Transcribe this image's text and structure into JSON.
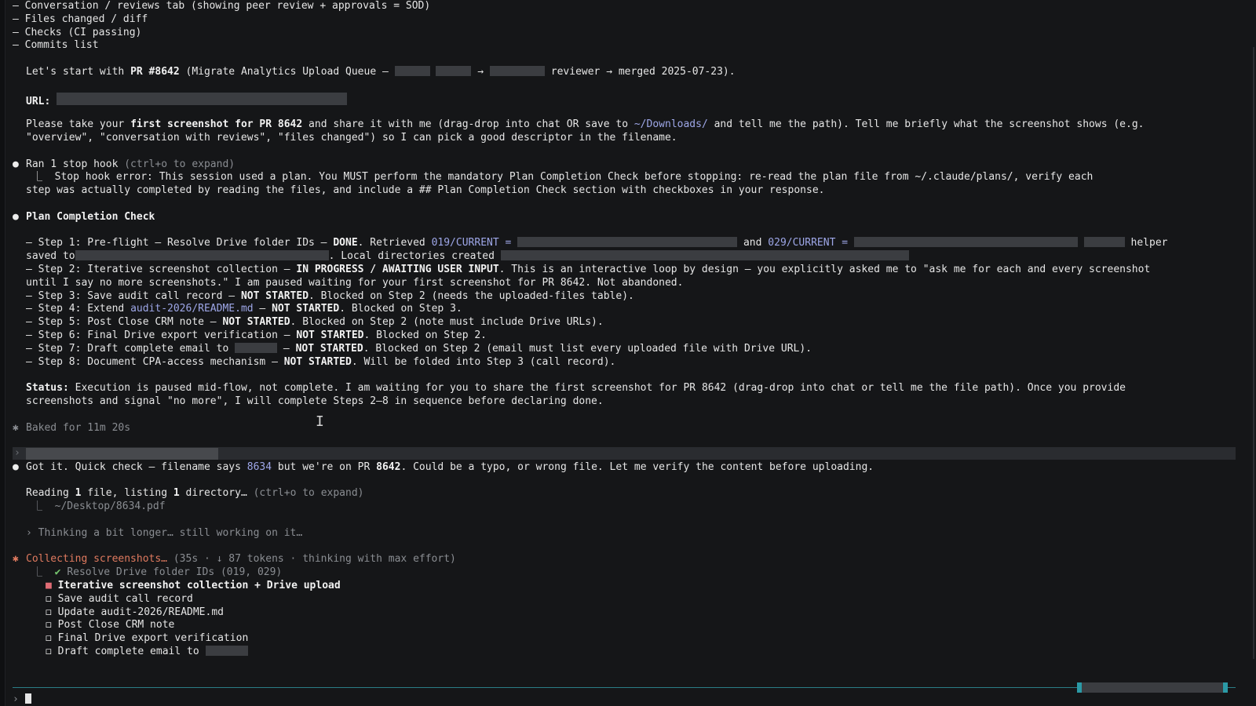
{
  "top_list": [
    "– Conversation / reviews tab (showing peer review + approvals = SOD)",
    "– Files changed / diff",
    "– Checks (CI passing)",
    "– Commits list"
  ],
  "pr_intro": {
    "prefix": "Let's start with ",
    "pr": "PR #8642",
    "mid": " (Migrate Analytics Upload Queue — ",
    "arrow1": " → ",
    "tail": " reviewer → merged 2025-07-23)."
  },
  "url_label": "URL:",
  "screenshot_request": {
    "p1": "Please take your ",
    "bold": "first screenshot for PR 8642",
    "p2": " and share it with me (drag-drop into chat OR save to ",
    "path": "~/Downloads/",
    "p3": " and tell me the path). Tell me briefly what the screenshot shows (e.g.",
    "line2": "\"overview\", \"conversation with reviews\", \"files changed\") so I can pick a good descriptor in the filename."
  },
  "stop_hook": {
    "title": "Ran 1 stop hook",
    "hint": " (ctrl+o to expand)",
    "err1": "⎿  Stop hook error: This session used a plan. You MUST perform the mandatory Plan Completion Check before stopping: re-read the plan file from ~/.claude/plans/, verify each",
    "err2": "step was actually completed by reading the files, and include a ## Plan Completion Check section with checkboxes in your response."
  },
  "plan_check_title": "Plan Completion Check",
  "steps": {
    "s1_a": "– Step 1: Pre-flight — Resolve Drive folder IDs — ",
    "s1_done": "DONE",
    "s1_b": ". Retrieved ",
    "s1_c019": "019/CURRENT =",
    "s1_and": " and ",
    "s1_c029": "029/CURRENT =",
    "s1_helper": " helper",
    "s1_saved": "saved to",
    "s1_local": ". Local directories created ",
    "s2_a": "– Step 2: Iterative screenshot collection — ",
    "s2_status": "IN PROGRESS / AWAITING USER INPUT",
    "s2_b": ". This is an interactive loop by design — you explicitly asked me to \"ask me for each and every screenshot",
    "s2_c": "until I say no more screenshots.\" I am paused waiting for your first screenshot for PR 8642. Not abandoned.",
    "s3_a": "– Step 3: Save audit call record — ",
    "s3_b": ". Blocked on Step 2 (needs the uploaded-files table).",
    "s4_a": "– Step 4: Extend ",
    "s4_link": "audit-2026/README.md",
    "s4_b": " — ",
    "s4_c": ". Blocked on Step 3.",
    "s5_a": "– Step 5: Post Close CRM note — ",
    "s5_b": ". Blocked on Step 2 (note must include Drive URLs).",
    "s6_a": "– Step 6: Final Drive export verification — ",
    "s6_b": ". Blocked on Step 2.",
    "s7_a": "– Step 7: Draft complete email to ",
    "s7_b": " — ",
    "s7_c": ". Blocked on Step 2 (email must list every uploaded file with Drive URL).",
    "s8_a": "– Step 8: Document CPA-access mechanism — ",
    "s8_b": ". Will be folded into Step 3 (call record).",
    "not_started": "NOT STARTED"
  },
  "status": {
    "label": "Status:",
    "l1": " Execution is paused mid-flow, not complete. I am waiting for you to share the first screenshot for PR 8642 (drag-drop into chat or tell me the file path). Once you provide",
    "l2": "screenshots and signal \"no more\", I will complete Steps 2–8 in sequence before declaring done."
  },
  "baked": "Baked for 11m 20s",
  "input_chevron": "›",
  "got_it": {
    "a": "Got it. Quick check — filename says ",
    "n1": "8634",
    "b": " but we're on PR ",
    "n2": "8642",
    "c": ". Could be a typo, or wrong file. Let me verify the content before uploading."
  },
  "reading": {
    "a": "Reading ",
    "n1": "1",
    "b": " file, listing ",
    "n2": "1",
    "c": " directory…",
    "hint": " (ctrl+o to expand)",
    "path": "⎿  ~/Desktop/8634.pdf"
  },
  "thinking": "› Thinking a bit longer… still working on it…",
  "collecting": {
    "label": "Collecting screenshots…",
    "meta": " (35s · ↓ 87 tokens · thinking with max effort)"
  },
  "todos": {
    "t1": "Resolve Drive folder IDs (019, 029)",
    "t2": "Iterative screenshot collection + Drive upload",
    "t3": "Save audit call record",
    "t4": "Update audit-2026/README.md",
    "t5": "Post Close CRM note",
    "t6": "Final Drive export verification",
    "t7": "Draft complete email to "
  },
  "prompt_char": "›"
}
